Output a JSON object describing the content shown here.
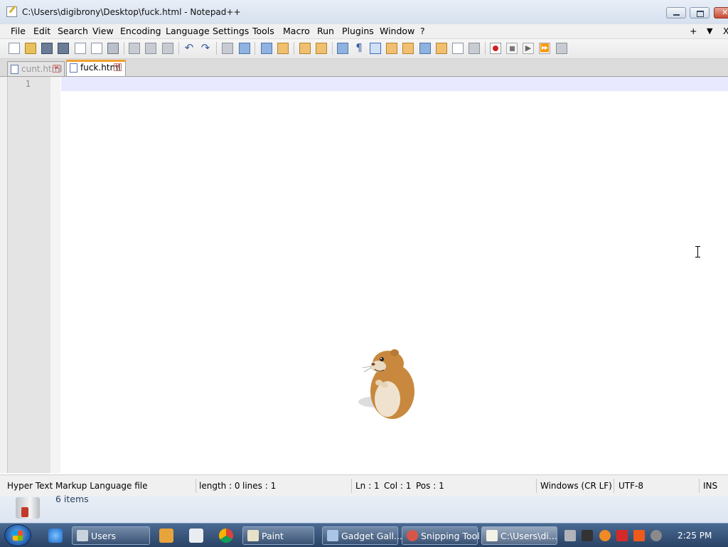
{
  "window": {
    "title": "C:\\Users\\digibrony\\Desktop\\fuck.html - Notepad++"
  },
  "menu": {
    "items": [
      "File",
      "Edit",
      "Search",
      "View",
      "Encoding",
      "Language",
      "Settings",
      "Tools",
      "Macro",
      "Run",
      "Plugins",
      "Window",
      "?"
    ],
    "right_plus": "+",
    "right_down": "▼",
    "right_close": "X"
  },
  "toolbar": {
    "icons": [
      "new-file-icon",
      "open-file-icon",
      "save-icon",
      "save-all-icon",
      "close-icon",
      "close-all-icon",
      "print-icon",
      "cut-icon",
      "copy-icon",
      "paste-icon",
      "undo-icon",
      "redo-icon",
      "find-icon",
      "replace-icon",
      "zoom-in-icon",
      "zoom-out-icon",
      "sync-vertical-icon",
      "sync-horizontal-icon",
      "word-wrap-icon",
      "show-all-characters-icon",
      "indent-guide-icon",
      "user-defined-language-icon",
      "document-map-icon",
      "function-list-icon",
      "folder-as-workspace-icon",
      "monitoring-icon",
      "eye-icon",
      "record-macro-icon",
      "stop-macro-icon",
      "play-macro-icon",
      "play-macro-multiple-icon",
      "save-macro-icon"
    ]
  },
  "tabs": [
    {
      "label": "cunt.html",
      "active": false
    },
    {
      "label": "fuck.html",
      "active": true
    }
  ],
  "editor": {
    "line_numbers": [
      "1"
    ],
    "content": ""
  },
  "status": {
    "file_type": "Hyper Text Markup Language file",
    "length": "length : 0",
    "lines": "lines : 1",
    "ln": "Ln : 1",
    "col": "Col : 1",
    "pos": "Pos : 1",
    "eol": "Windows (CR LF)",
    "encoding": "UTF-8",
    "mode": "INS"
  },
  "explorer": {
    "item_count": "6 items"
  },
  "taskbar": {
    "tasks": [
      {
        "label": "Users",
        "icon": "explorer-icon",
        "active": false
      },
      {
        "label": "Paint",
        "icon": "paint-icon",
        "active": false
      },
      {
        "label": "Gadget Gall...",
        "icon": "gadget-icon",
        "active": false
      },
      {
        "label": "Snipping Tool",
        "icon": "snipping-tool-icon",
        "active": false
      },
      {
        "label": "C:\\Users\\di...",
        "icon": "notepadpp-icon",
        "active": true
      }
    ],
    "clock": "2:25 PM"
  },
  "colors": {
    "active_tab_accent": "#f0a030",
    "current_line": "#e8e8ff",
    "taskbar": "#2a4366"
  }
}
